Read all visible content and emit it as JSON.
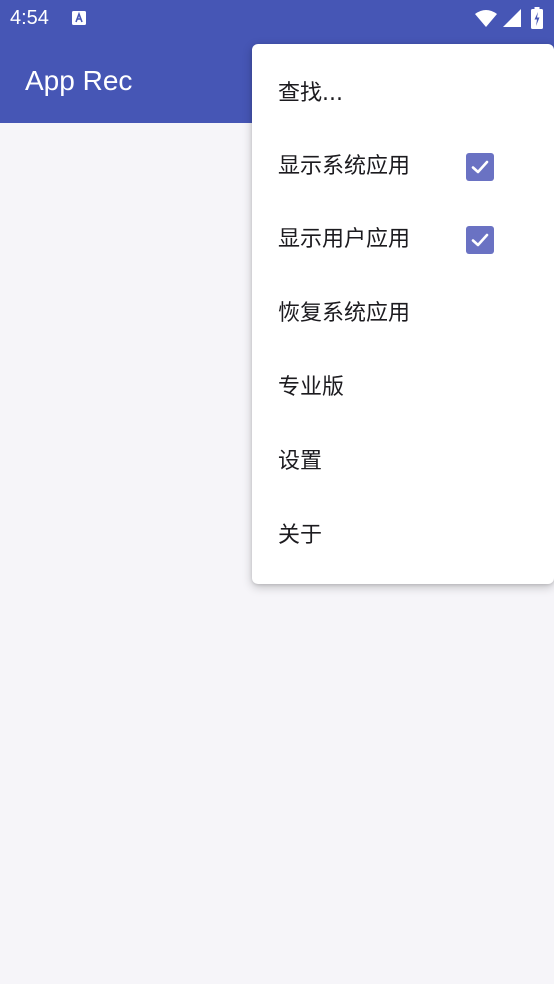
{
  "status_bar": {
    "time": "4:54",
    "icons": [
      "text-a-icon",
      "wifi-icon",
      "signal-icon",
      "battery-charging-icon"
    ]
  },
  "app_bar": {
    "title": "App Rec",
    "background": "#4656b5"
  },
  "menu": {
    "items": [
      {
        "label": "查找...",
        "checkbox": false
      },
      {
        "label": "显示系统应用",
        "checkbox": true,
        "checked": true
      },
      {
        "label": "显示用户应用",
        "checkbox": true,
        "checked": true
      },
      {
        "label": "恢复系统应用",
        "checkbox": false
      },
      {
        "label": "专业版",
        "checkbox": false
      },
      {
        "label": "设置",
        "checkbox": false
      },
      {
        "label": "关于",
        "checkbox": false
      }
    ]
  },
  "colors": {
    "primary": "#4656b5",
    "checkbox": "#6a72c3",
    "background": "#f6f5f9"
  }
}
